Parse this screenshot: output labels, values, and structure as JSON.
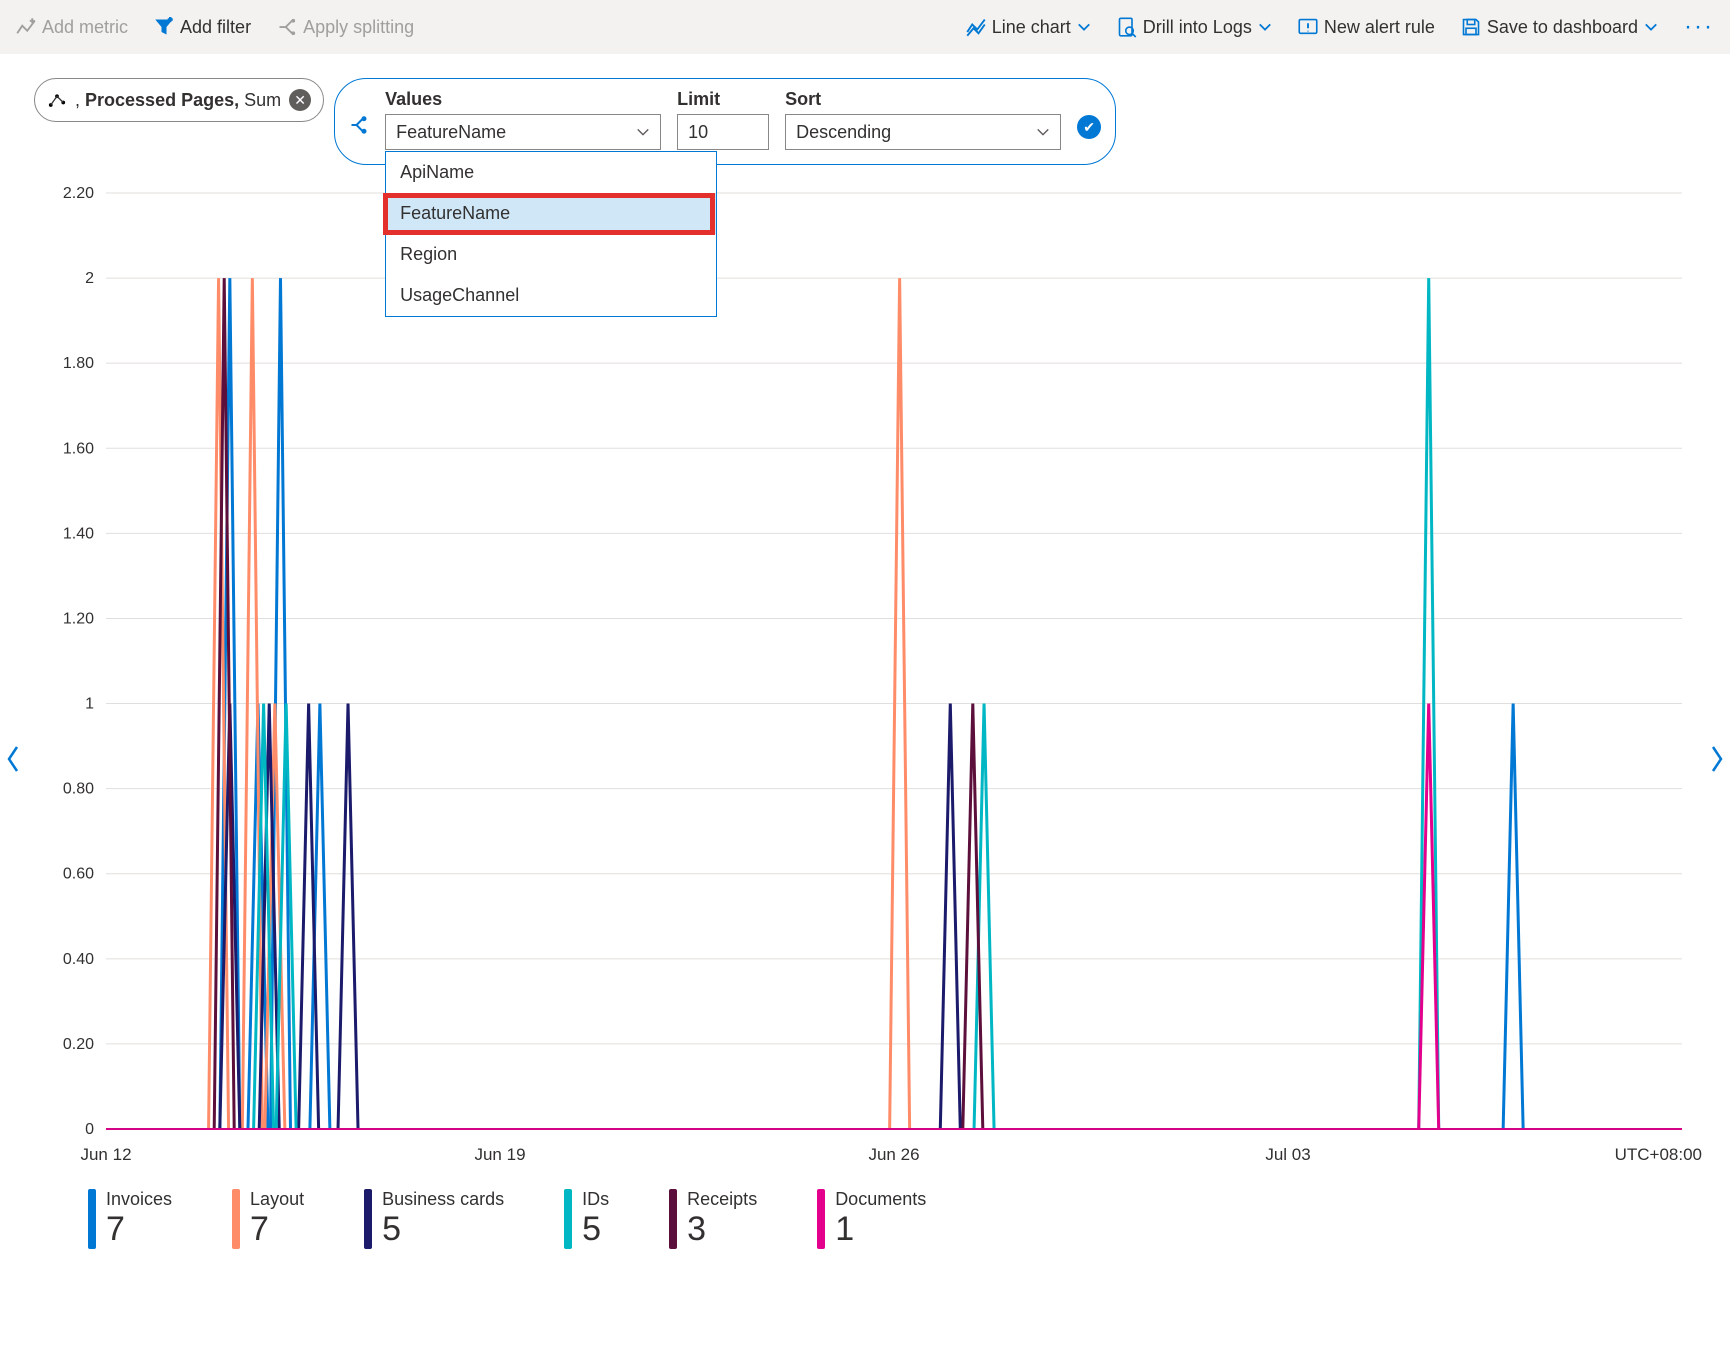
{
  "toolbar": {
    "add_metric": "Add metric",
    "add_filter": "Add filter",
    "apply_splitting": "Apply splitting",
    "line_chart": "Line chart",
    "drill_logs": "Drill into Logs",
    "new_alert": "New alert rule",
    "save_dash": "Save to dashboard"
  },
  "metric_pill": {
    "prefix": ", ",
    "metric": "Processed Pages,",
    "agg": " Sum"
  },
  "split_panel": {
    "values_label": "Values",
    "values_value": "FeatureName",
    "limit_label": "Limit",
    "limit_value": "10",
    "sort_label": "Sort",
    "sort_value": "Descending",
    "options": [
      "ApiName",
      "FeatureName",
      "Region",
      "UsageChannel"
    ],
    "selected_option": "FeatureName"
  },
  "chart_data": {
    "type": "line",
    "xlabel": "",
    "ylabel": "",
    "ylim": [
      0,
      2.2
    ],
    "yticks": [
      0,
      0.2,
      0.4,
      0.6,
      0.8,
      1,
      1.2,
      1.4,
      1.6,
      1.8,
      2,
      2.2
    ],
    "x_ticks": [
      "Jun 12",
      "Jun 19",
      "Jun 26",
      "Jul 03"
    ],
    "x_range_days": 28,
    "timezone_label": "UTC+08:00",
    "series": [
      {
        "name": "Invoices",
        "color": "#0078d4",
        "total": 7,
        "points": [
          {
            "d": 2.2,
            "v": 2
          },
          {
            "d": 2.7,
            "v": 1
          },
          {
            "d": 3.1,
            "v": 2
          },
          {
            "d": 3.8,
            "v": 1
          },
          {
            "d": 25.0,
            "v": 1
          }
        ]
      },
      {
        "name": "Layout",
        "color": "#ff8c69",
        "total": 7,
        "points": [
          {
            "d": 2.0,
            "v": 2
          },
          {
            "d": 2.6,
            "v": 2
          },
          {
            "d": 3.0,
            "v": 1
          },
          {
            "d": 14.1,
            "v": 2
          }
        ]
      },
      {
        "name": "Business cards",
        "color": "#1b1a6b",
        "total": 5,
        "points": [
          {
            "d": 2.2,
            "v": 1
          },
          {
            "d": 2.9,
            "v": 1
          },
          {
            "d": 3.6,
            "v": 1
          },
          {
            "d": 4.3,
            "v": 1
          },
          {
            "d": 15.0,
            "v": 1
          }
        ]
      },
      {
        "name": "IDs",
        "color": "#00b7c3",
        "total": 5,
        "points": [
          {
            "d": 2.8,
            "v": 1
          },
          {
            "d": 3.2,
            "v": 1
          },
          {
            "d": 15.6,
            "v": 1
          },
          {
            "d": 23.5,
            "v": 2
          }
        ]
      },
      {
        "name": "Receipts",
        "color": "#5c0f3a",
        "total": 3,
        "points": [
          {
            "d": 2.1,
            "v": 2
          },
          {
            "d": 15.4,
            "v": 1
          }
        ]
      },
      {
        "name": "Documents",
        "color": "#e3008c",
        "total": 1,
        "points": [
          {
            "d": 23.5,
            "v": 1
          }
        ]
      }
    ]
  }
}
